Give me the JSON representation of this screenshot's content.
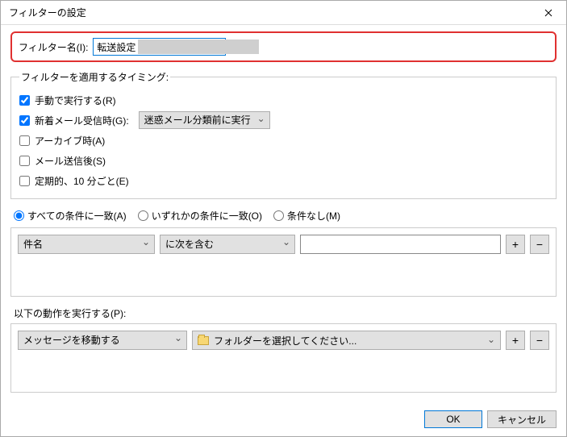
{
  "window": {
    "title": "フィルターの設定"
  },
  "filterName": {
    "label": "フィルター名(I):",
    "value": "転送設定"
  },
  "timing": {
    "legend": "フィルターを適用するタイミング:",
    "manual": {
      "label": "手動で実行する(R)",
      "checked": true
    },
    "incoming": {
      "label": "新着メール受信時(G):",
      "checked": true,
      "select": "迷惑メール分類前に実行"
    },
    "archive": {
      "label": "アーカイブ時(A)",
      "checked": false
    },
    "aftersend": {
      "label": "メール送信後(S)",
      "checked": false
    },
    "periodic": {
      "label": "定期的、10 分ごと(E)",
      "checked": false
    }
  },
  "match": {
    "all": "すべての条件に一致(A)",
    "any": "いずれかの条件に一致(O)",
    "none": "条件なし(M)"
  },
  "rule": {
    "field": "件名",
    "op": "に次を含む",
    "value": ""
  },
  "actions": {
    "legend": "以下の動作を実行する(P):",
    "action": "メッセージを移動する",
    "folder": "フォルダーを選択してください..."
  },
  "buttons": {
    "ok": "OK",
    "cancel": "キャンセル",
    "plus": "+",
    "minus": "−"
  }
}
